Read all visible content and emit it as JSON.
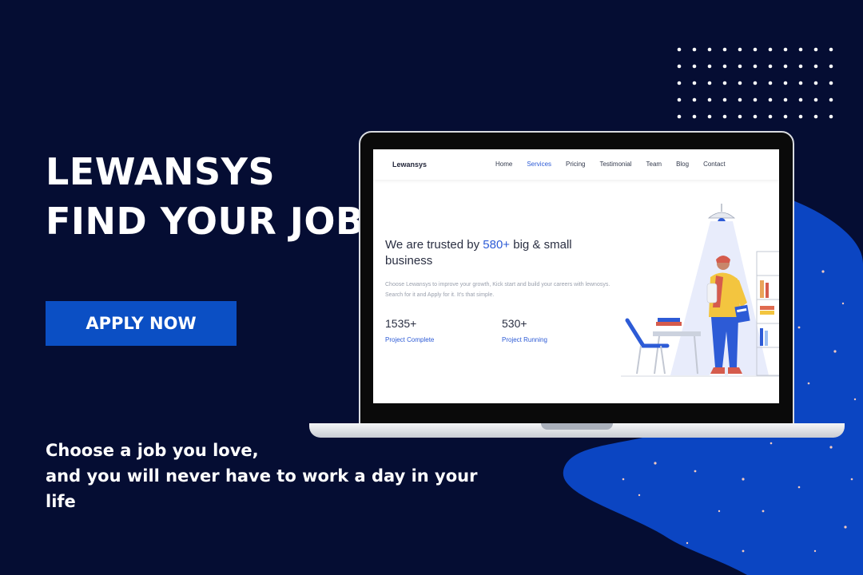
{
  "headline": {
    "line1": "LEWANSYS",
    "line2": "FIND YOUR JOB"
  },
  "cta": {
    "apply_label": "APPLY NOW"
  },
  "quote": {
    "line1": "Choose a job you love,",
    "line2": "and you will never have to work a day in your",
    "line3": "life"
  },
  "website": {
    "brand": "Lewansys",
    "nav": [
      {
        "label": "Home",
        "active": false
      },
      {
        "label": "Services",
        "active": true
      },
      {
        "label": "Pricing",
        "active": false
      },
      {
        "label": "Testimonial",
        "active": false
      },
      {
        "label": "Team",
        "active": false
      },
      {
        "label": "Blog",
        "active": false
      },
      {
        "label": "Contact",
        "active": false
      }
    ],
    "heading_prefix": "We are trusted by ",
    "heading_accent": "580+",
    "heading_suffix": " big & small business",
    "paragraph": "Choose Lewansys to improve your growth, Kick start and build your careers with lewnosys. Search for it and Apply for it. It's that simple.",
    "stats": [
      {
        "value": "1535+",
        "label": "Project Complete"
      },
      {
        "value": "530+",
        "label": "Project Running"
      }
    ]
  },
  "icons": {
    "dot-grid": "dot-grid-icon",
    "illustration": "person-with-books-illustration"
  },
  "colors": {
    "background": "#050d33",
    "accent_blue": "#0b4fc4",
    "blob_blue": "#0b45c2",
    "site_accent": "#2d5bd6",
    "text_white": "#ffffff"
  }
}
